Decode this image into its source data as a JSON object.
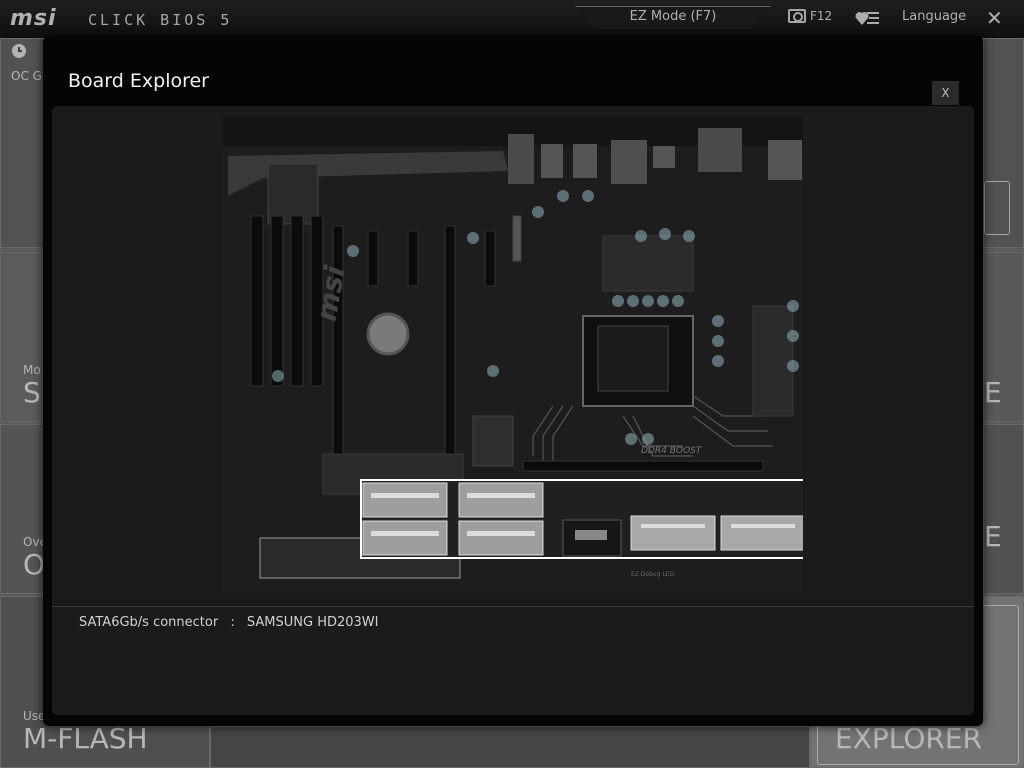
{
  "header": {
    "brand": "msi",
    "product": "CLICK BIOS 5",
    "ez_mode_label": "EZ Mode (F7)",
    "screenshot_key": "F12",
    "language_label": "Language",
    "close_glyph": "✕"
  },
  "background": {
    "oc_tile_label": "OC G",
    "settings_tile_small": "Mo",
    "settings_tile_big": "S",
    "oc_small": "Ove",
    "oc_big": "O",
    "mflash_small": "Use",
    "mflash_big": "M-FLASH",
    "explorer_big": "EXPLORER",
    "right_big_1": "E",
    "right_big_2": "E"
  },
  "modal": {
    "title": "Board Explorer",
    "close_label": "X",
    "status": {
      "component": "SATA6Gb/s connector",
      "separator": ":",
      "device": "SAMSUNG HD203WI"
    }
  },
  "board": {
    "silk_ddr4": "DDR4 BOOST",
    "silk_debug": "EZ Debug LED",
    "silk_brand": "msi",
    "highlighted_component": "SATA6Gb/s connectors"
  },
  "colors": {
    "accent_highlight": "#ffffff",
    "capacitor": "#8fb3bd",
    "pcb": "#1e1e1e"
  },
  "icons": [
    "camera-icon",
    "favorites-icon",
    "close-icon",
    "clock-icon"
  ]
}
